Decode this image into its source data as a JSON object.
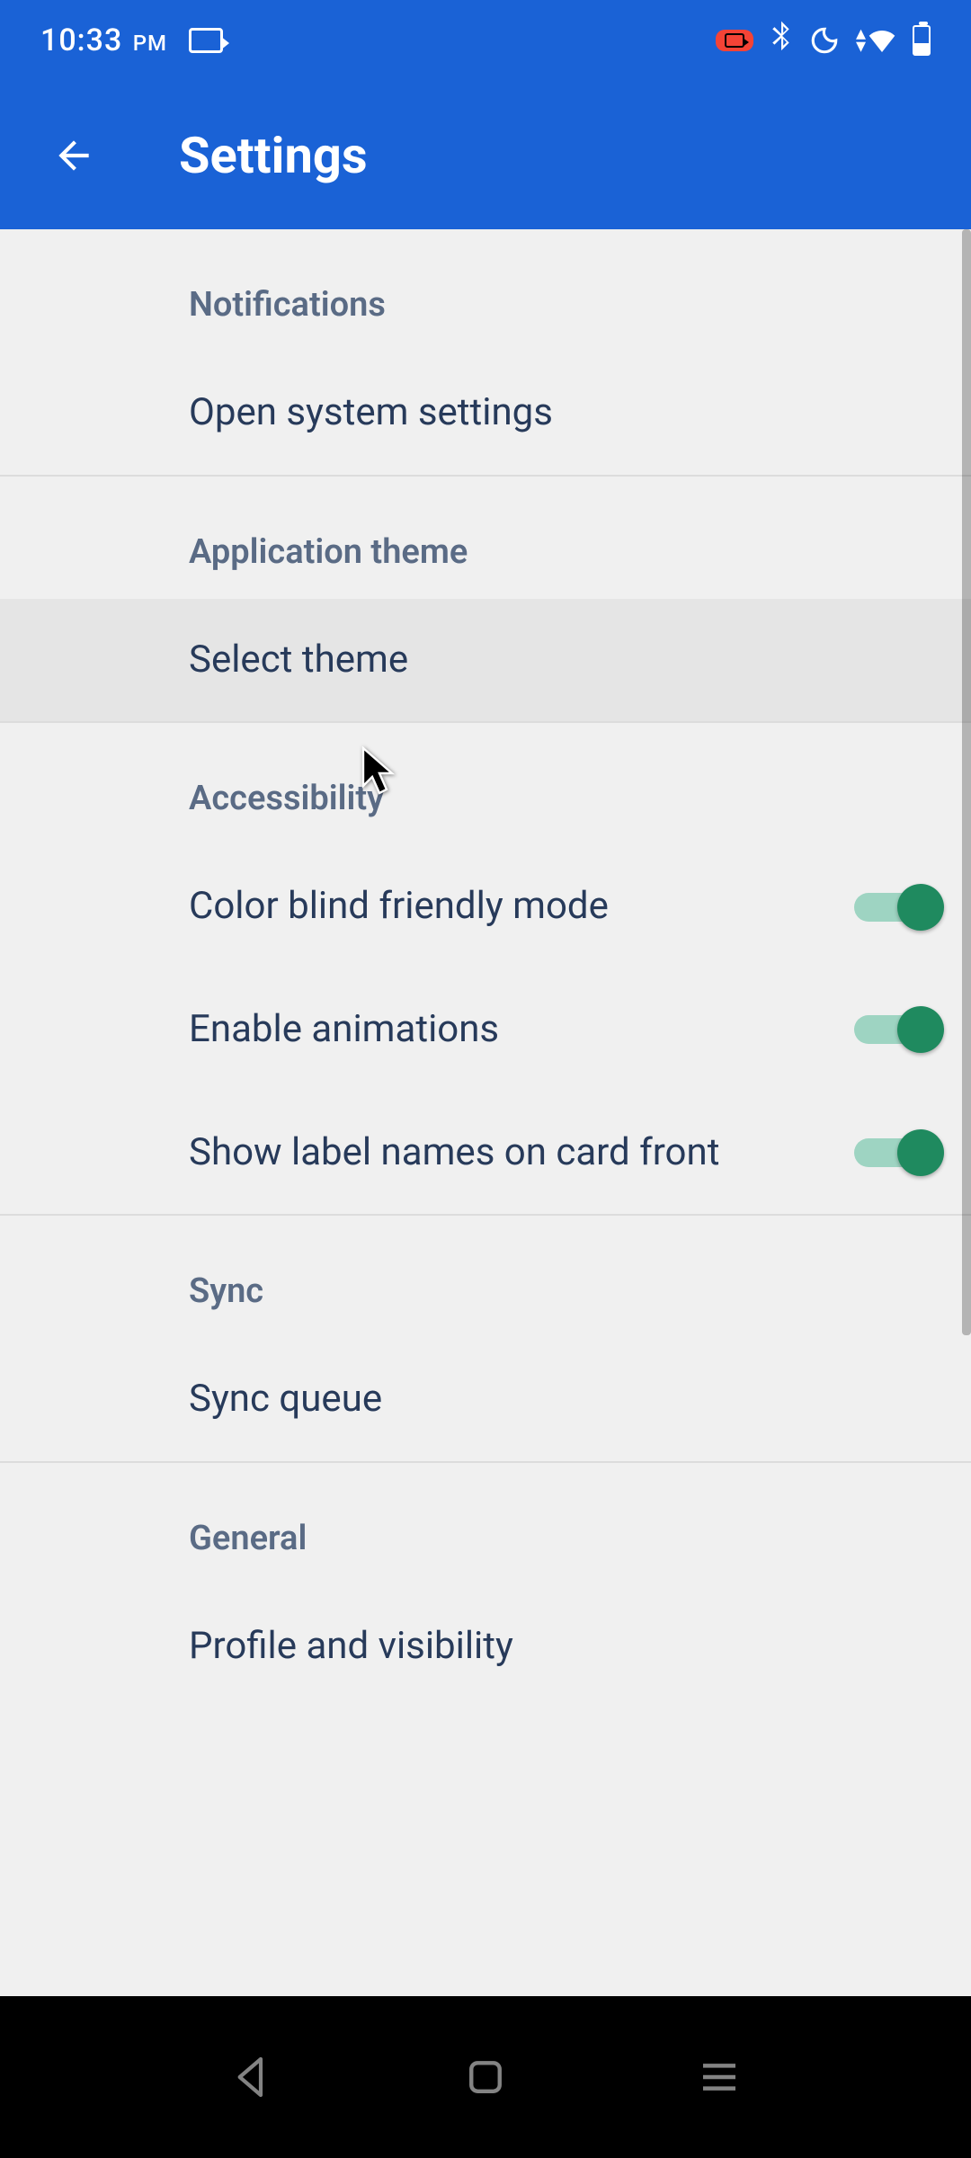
{
  "status": {
    "time": "10:33",
    "ampm": "PM"
  },
  "appbar": {
    "title": "Settings"
  },
  "sections": {
    "notifications": {
      "header": "Notifications",
      "open_system": "Open system settings"
    },
    "theme": {
      "header": "Application theme",
      "select_theme": "Select theme"
    },
    "accessibility": {
      "header": "Accessibility",
      "color_blind": "Color blind friendly mode",
      "animations": "Enable animations",
      "labels_on_card": "Show label names on card front"
    },
    "sync": {
      "header": "Sync",
      "sync_queue": "Sync queue"
    },
    "general": {
      "header": "General",
      "profile_visibility": "Profile and visibility"
    }
  },
  "toggles": {
    "color_blind": true,
    "animations": true,
    "labels_on_card": true
  }
}
